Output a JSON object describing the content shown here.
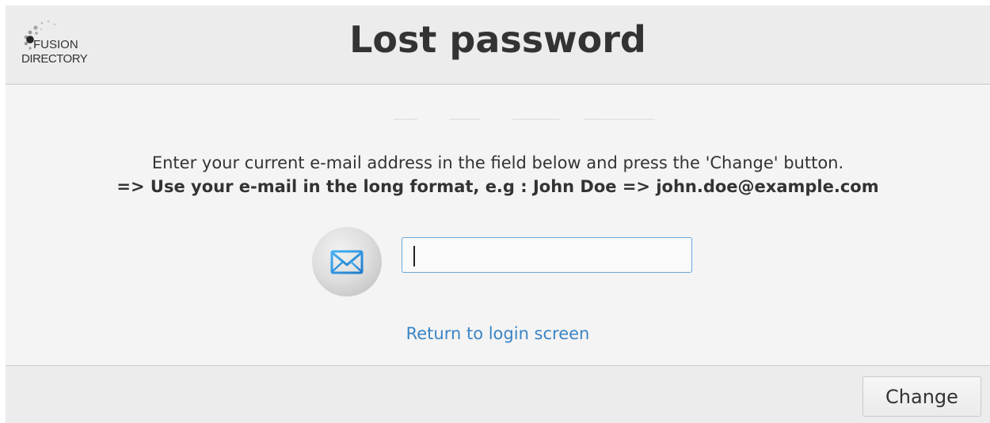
{
  "header": {
    "title": "Lost password",
    "logo": {
      "line1": "FUSION",
      "line2": "DIRECTORY",
      "icon": "fusiondirectory-logo"
    }
  },
  "form": {
    "instruction": "Enter your current e-mail address in the field below and press the 'Change' button.",
    "hint": "=> Use your e-mail in the long format, e.g : John Doe => john.doe@example.com",
    "email_icon": "envelope-icon",
    "email_value": "",
    "email_placeholder": ""
  },
  "links": {
    "return_login": "Return to login screen"
  },
  "footer": {
    "change_label": "Change"
  },
  "colors": {
    "link": "#3a84c4",
    "input_border": "#6aa7d8",
    "envelope": "#2f96e0",
    "background": "#f4f4f4",
    "header_background": "#ececec"
  }
}
